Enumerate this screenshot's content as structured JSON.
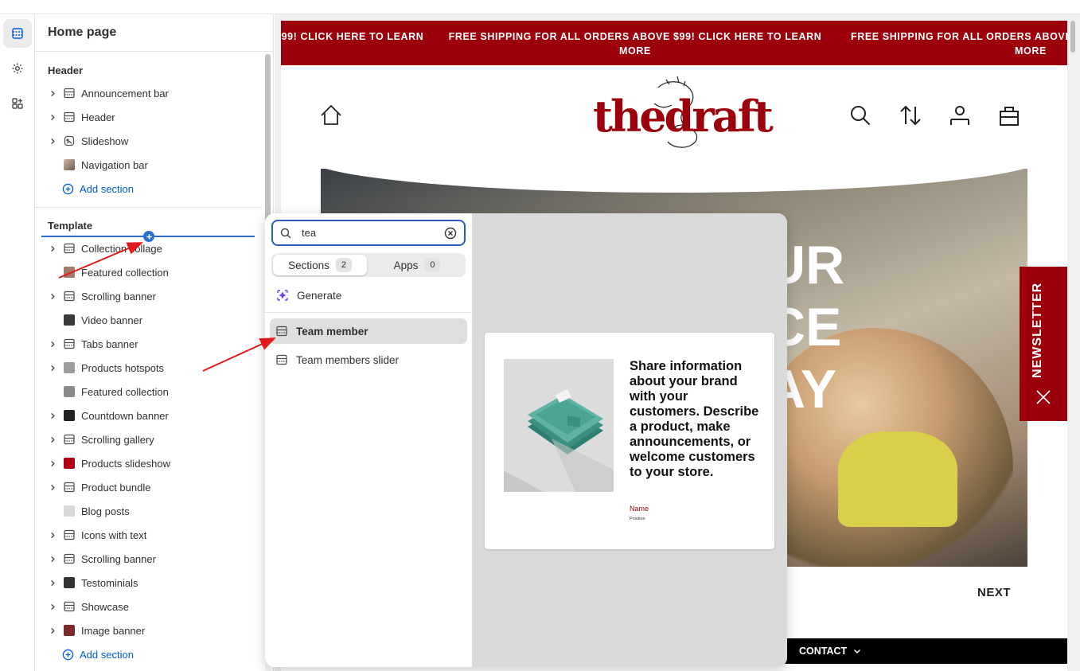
{
  "sidebar": {
    "title": "Home page",
    "header_group": "Header",
    "header_items": [
      {
        "label": "Announcement bar"
      },
      {
        "label": "Header"
      },
      {
        "label": "Slideshow"
      },
      {
        "label": "Navigation bar"
      }
    ],
    "add_section": "Add section",
    "template_group": "Template",
    "template_items": [
      {
        "label": "Collection collage"
      },
      {
        "label": "Featured collection"
      },
      {
        "label": "Scrolling banner"
      },
      {
        "label": "Video banner"
      },
      {
        "label": "Tabs banner"
      },
      {
        "label": "Products hotspots"
      },
      {
        "label": "Featured collection"
      },
      {
        "label": "Countdown banner"
      },
      {
        "label": "Scrolling gallery"
      },
      {
        "label": "Products slideshow"
      },
      {
        "label": "Product bundle"
      },
      {
        "label": "Blog posts"
      },
      {
        "label": "Icons with text"
      },
      {
        "label": "Scrolling banner"
      },
      {
        "label": "Testominials"
      },
      {
        "label": "Showcase"
      },
      {
        "label": "Image banner"
      }
    ],
    "add_section_2": "Add section"
  },
  "picker": {
    "search_value": "tea",
    "tabs": [
      {
        "label": "Sections",
        "count": "2"
      },
      {
        "label": "Apps",
        "count": "0"
      }
    ],
    "generate_label": "Generate",
    "results": [
      {
        "label": "Team member"
      },
      {
        "label": "Team members slider"
      }
    ],
    "preview": {
      "text": "Share information about your brand with your customers. Describe a product, make announcements, or welcome customers to your store.",
      "name": "Name",
      "position": "Position"
    }
  },
  "store": {
    "announcement_left": "99! CLICK HERE TO LEARN",
    "announcement_mid_1": "FREE SHIPPING FOR ALL ORDERS ABOVE $99! CLICK HERE TO LEARN",
    "announcement_mid_2": "MORE",
    "announcement_right_1": "FREE SHIPPING FOR ALL ORDERS ABOVE",
    "announcement_right_2": "MORE",
    "logo": "thedraft",
    "hero_line_1": "UR",
    "hero_line_2": "CE",
    "hero_line_3": "AY",
    "next_label": "NEXT",
    "newsletter_label": "NEWSLETTER",
    "contact_label": "CONTACT"
  },
  "colors": {
    "brand": "#9b000b",
    "accent": "#005bd3",
    "focus": "#2c5bb8"
  }
}
